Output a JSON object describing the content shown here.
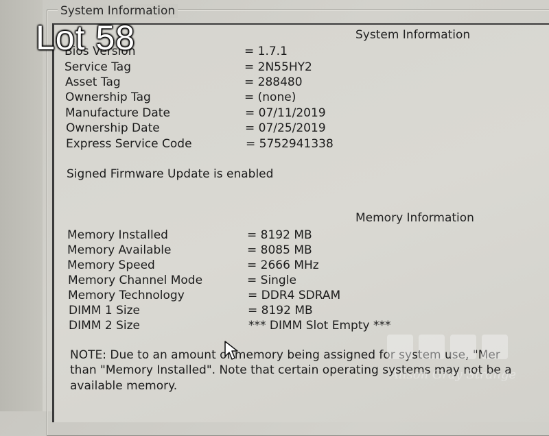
{
  "group_title": "System Information",
  "system_heading": "System Information",
  "system_rows": [
    {
      "label": "Bios Version",
      "value": "= 1.7.1"
    },
    {
      "label": "Service Tag",
      "value": "= 2N55HY2"
    },
    {
      "label": "Asset Tag",
      "value": "= 288480"
    },
    {
      "label": "Ownership Tag",
      "value": "= (none)"
    },
    {
      "label": "Manufacture Date",
      "value": "= 07/11/2019"
    },
    {
      "label": "Ownership Date",
      "value": "= 07/25/2019"
    },
    {
      "label": "Express Service Code",
      "value": "= 5752941338"
    }
  ],
  "firmware_status": "Signed Firmware Update is enabled",
  "memory_heading": "Memory Information",
  "memory_rows": [
    {
      "label": "Memory Installed",
      "value": "= 8192 MB"
    },
    {
      "label": "Memory Available",
      "value": "= 8085 MB"
    },
    {
      "label": "Memory Speed",
      "value": "= 2666 MHz"
    },
    {
      "label": "Memory Channel Mode",
      "value": "= Single"
    },
    {
      "label": "Memory Technology",
      "value": "= DDR4 SDRAM"
    },
    {
      "label": "DIMM 1 Size",
      "value": "= 8192 MB"
    },
    {
      "label": "DIMM 2 Size",
      "value": "*** DIMM Slot Empty ***"
    }
  ],
  "note_lines": [
    "NOTE: Due to an amount of memory being assigned for system use, \"Mer",
    "than \"Memory Installed\". Note that certain operating systems may not be a",
    "available memory."
  ],
  "overlay": {
    "lot_label": "Lot 58",
    "watermark": "Alison Gray Strange"
  },
  "colors": {
    "screen_bg": "#d3d2cc",
    "text": "#1c1c1c",
    "overlay_text": "#ffffff"
  }
}
